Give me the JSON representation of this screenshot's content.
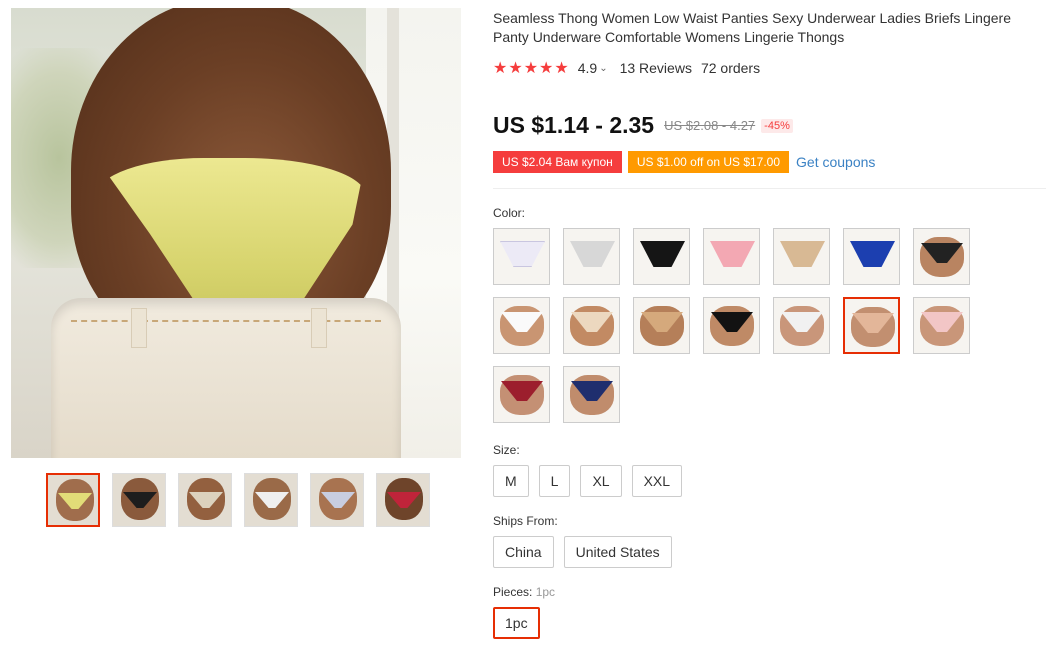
{
  "product": {
    "title": "Seamless Thong Women Low Waist Panties Sexy Underwear Ladies Briefs Lingere Panty Underware Comfortable Womens Lingerie Thongs",
    "stars": "★★★★★",
    "rating": "4.9",
    "rating_chevron": "⌄",
    "reviews": "13 Reviews",
    "orders": "72 orders",
    "price": "US $1.14 - 2.35",
    "original_price": "US $2.08 - 4.27",
    "discount": "-45%"
  },
  "coupons": {
    "items": [
      {
        "label": "US $2.04 Вам купон",
        "color": "#f53d3d"
      },
      {
        "label": "US $1.00 off on US $17.00",
        "color": "#ff9a00"
      }
    ],
    "get_coupons": "Get coupons"
  },
  "color": {
    "label": "Color:",
    "swatch_count": 16,
    "selected_index": 12
  },
  "size": {
    "label": "Size:",
    "options": [
      "M",
      "L",
      "XL",
      "XXL"
    ]
  },
  "ships_from": {
    "label": "Ships From:",
    "options": [
      "China",
      "United States"
    ]
  },
  "pieces": {
    "label": "Pieces:",
    "selected_value": "1pc",
    "options": [
      "1pc"
    ]
  },
  "gallery": {
    "thumbnail_count": 6,
    "active_index": 0
  },
  "theme": {
    "accent": "#e62e04",
    "star_color": "#f53d3d",
    "link_color": "#3b82c4"
  }
}
